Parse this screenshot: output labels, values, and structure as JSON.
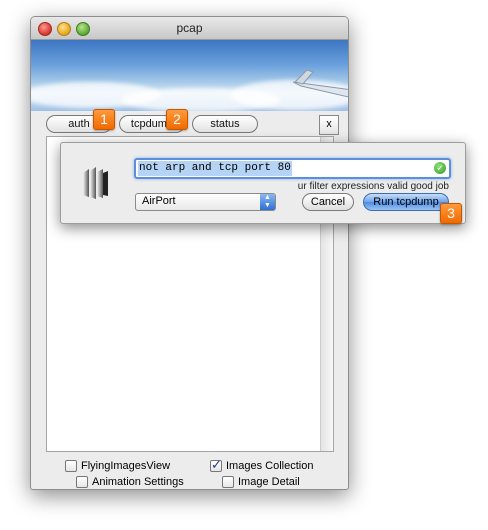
{
  "window": {
    "title": "pcap"
  },
  "tabs": [
    {
      "label": "auth"
    },
    {
      "label": "tcpdump"
    },
    {
      "label": "status"
    }
  ],
  "close_tabs_label": "x",
  "sheet": {
    "filter_value": "not arp and tcp port 80",
    "valid_message": "ur filter expressions valid good job",
    "interface_selected": "AirPort",
    "cancel_label": "Cancel",
    "run_label": "Run tcpdump"
  },
  "checkboxes": [
    {
      "label": "FlyingImagesView",
      "checked": false
    },
    {
      "label": "Images Collection",
      "checked": true
    },
    {
      "label": "Animation Settings",
      "checked": false
    },
    {
      "label": "Image Detail",
      "checked": false
    }
  ],
  "markers": [
    "1",
    "2",
    "3"
  ],
  "colors": {
    "marker": "#f07a10",
    "focus": "#5b8fd9",
    "valid": "#2f9c23"
  }
}
